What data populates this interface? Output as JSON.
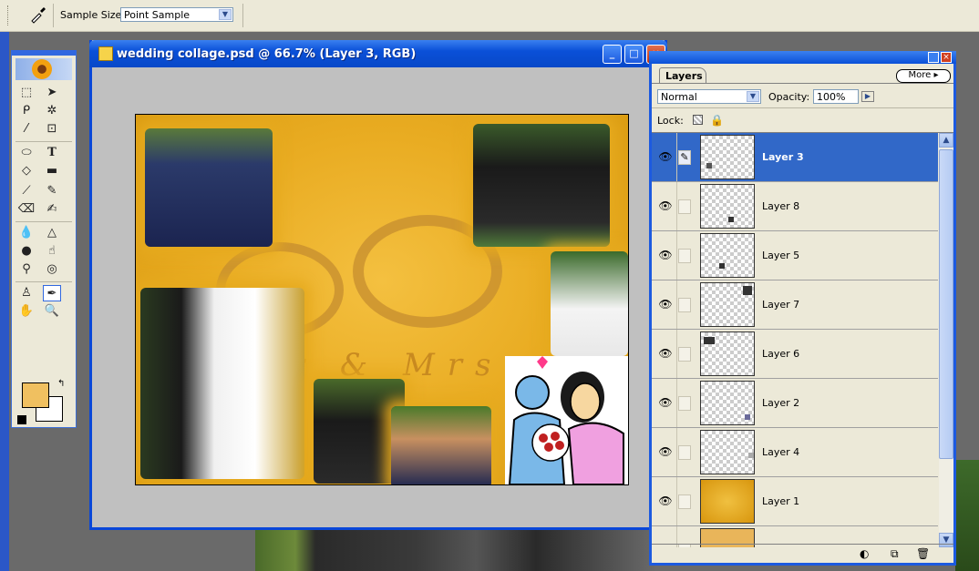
{
  "options_bar": {
    "sample_size_label": "Sample Size:",
    "sample_size_value": "Point Sample"
  },
  "document": {
    "title": "wedding collage.psd @ 66.7% (Layer 3, RGB)",
    "collage_text": "Mr & Mrs"
  },
  "tools": {
    "foreground_color": "#f0c060",
    "background_color": "#ffffff"
  },
  "layers_panel": {
    "tab_label": "Layers",
    "more_label": "More",
    "blend_mode": "Normal",
    "opacity_label": "Opacity:",
    "opacity_value": "100%",
    "lock_label": "Lock:",
    "layers": [
      {
        "name": "Layer 3",
        "selected": true
      },
      {
        "name": "Layer 8",
        "selected": false
      },
      {
        "name": "Layer 5",
        "selected": false
      },
      {
        "name": "Layer 7",
        "selected": false
      },
      {
        "name": "Layer 6",
        "selected": false
      },
      {
        "name": "Layer 2",
        "selected": false
      },
      {
        "name": "Layer 4",
        "selected": false
      },
      {
        "name": "Layer 1",
        "selected": false
      }
    ]
  }
}
